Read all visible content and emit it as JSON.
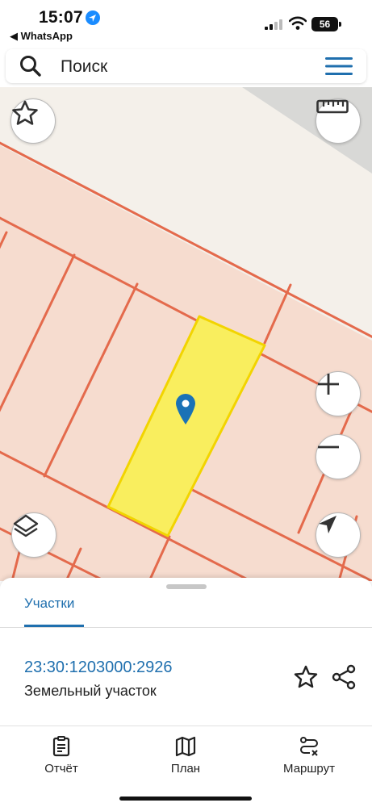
{
  "status_bar": {
    "time": "15:07",
    "back_app": "◀ WhatsApp",
    "battery": "56"
  },
  "search": {
    "label": "Поиск",
    "icons": [
      "search-icon",
      "hamburger-menu-icon"
    ]
  },
  "map": {
    "buttons": [
      "favorite-star-icon",
      "ruler-icon",
      "zoom-in-icon",
      "zoom-out-icon",
      "layers-icon",
      "locate-arrow-icon"
    ],
    "colors": {
      "parcel_fill": "#f6dccf",
      "boundary_line": "#e46a4c",
      "selected_fill": "#f9ee5e",
      "selected_outline": "#f2d400",
      "marker": "#1a72b6",
      "road": "#f4f0ea",
      "gray_area": "#d8d8d6"
    }
  },
  "sheet": {
    "tab": "Участки",
    "parcel": {
      "id": "23:30:1203000:2926",
      "type": "Земельный участок"
    },
    "actions": [
      "star-icon",
      "share-icon"
    ]
  },
  "bottom_nav": {
    "items": [
      {
        "label": "Отчёт",
        "icon": "report-icon"
      },
      {
        "label": "План",
        "icon": "map-plan-icon"
      },
      {
        "label": "Маршрут",
        "icon": "route-icon"
      }
    ]
  },
  "colors": {
    "accent": "#1f6fae"
  }
}
